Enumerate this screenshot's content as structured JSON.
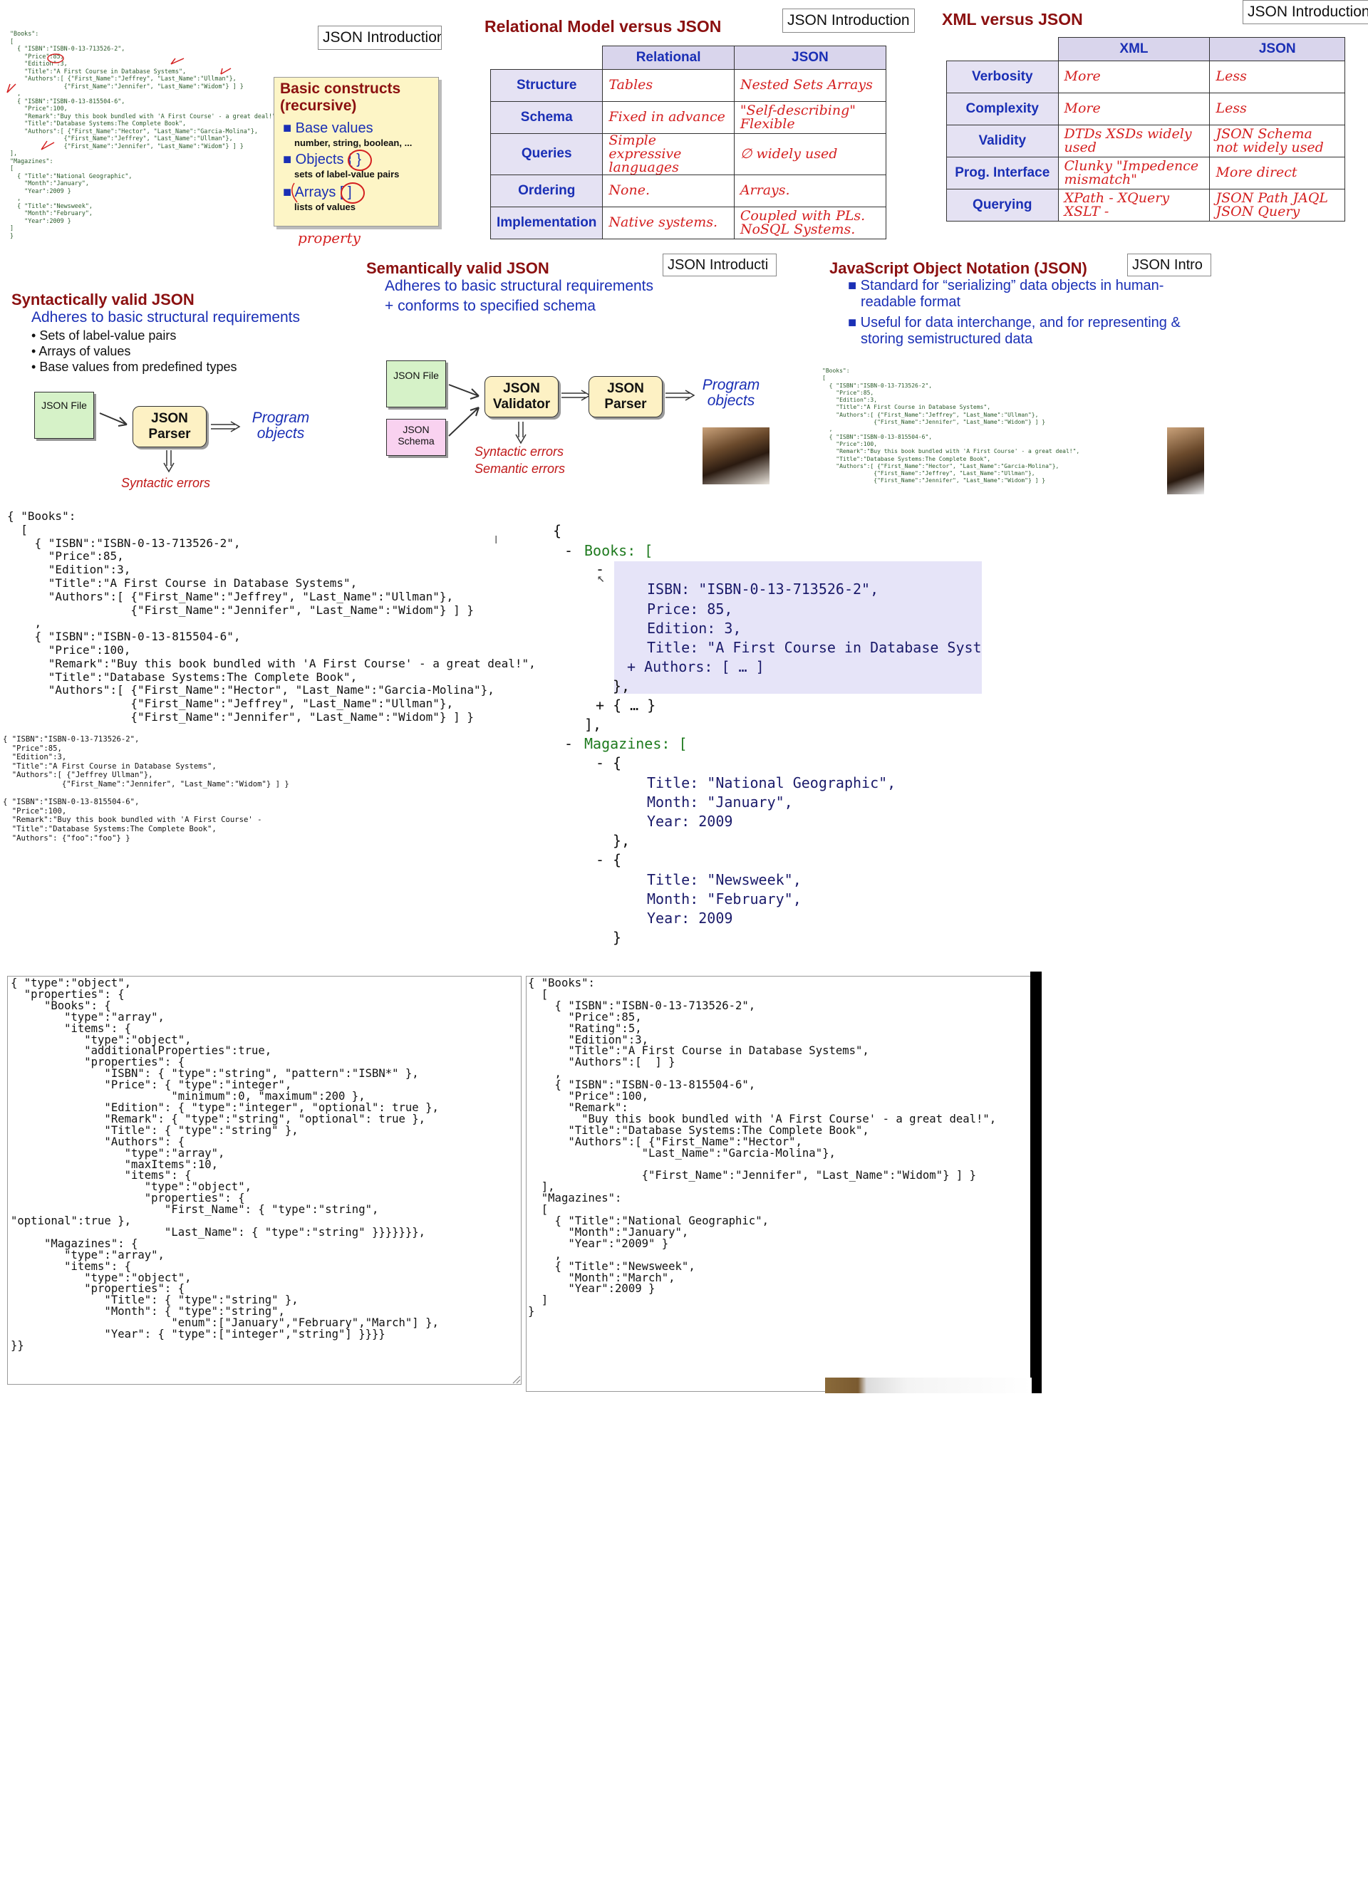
{
  "slide1": {
    "intro_label": "JSON Introduction",
    "code": "\"Books\":\n[\n  { \"ISBN\":\"ISBN-0-13-713526-2\",\n    \"Price\":85,\n    \"Edition\":3,\n    \"Title\":\"A First Course in Database Systems\",\n    \"Authors\":[ {\"First_Name\":\"Jeffrey\", \"Last_Name\":\"Ullman\"},\n               {\"First_Name\":\"Jennifer\", \"Last_Name\":\"Widom\"} ] }\n  ,\n  { \"ISBN\":\"ISBN-0-13-815504-6\",\n    \"Price\":100,\n    \"Remark\":\"Buy this book bundled with 'A First Course' - a great deal!\",\n    \"Title\":\"Database Systems:The Complete Book\",\n    \"Authors\":[ {\"First_Name\":\"Hector\", \"Last_Name\":\"Garcia-Molina\"},\n               {\"First_Name\":\"Jeffrey\", \"Last_Name\":\"Ullman\"},\n               {\"First_Name\":\"Jennifer\", \"Last_Name\":\"Widom\"} ] }\n],\n\"Magazines\":\n[\n  { \"Title\":\"National Geographic\",\n    \"Month\":\"January\",\n    \"Year\":2009 }\n  ,\n  { \"Title\":\"Newsweek\",\n    \"Month\":\"February\",\n    \"Year\":2009 }\n]\n}",
    "constructs_title": "Basic constructs (recursive)",
    "base_values": "Base values",
    "base_values_sub": "number, string, boolean, ...",
    "objects": "Objects { }",
    "objects_sub": "sets of label-value pairs",
    "arrays": "Arrays [ ]",
    "arrays_sub": "lists of values",
    "annotation": "property"
  },
  "slide2": {
    "title": "Relational Model versus JSON",
    "intro_label": "JSON Introduction",
    "columns": [
      "Relational",
      "JSON"
    ],
    "rows": [
      {
        "label": "Structure",
        "relational": "Tables",
        "json": "Nested Sets Arrays"
      },
      {
        "label": "Schema",
        "relational": "Fixed in advance",
        "json": "\"Self-describing\" Flexible"
      },
      {
        "label": "Queries",
        "relational": "Simple expressive languages",
        "json": "∅ widely used"
      },
      {
        "label": "Ordering",
        "relational": "None.",
        "json": "Arrays."
      },
      {
        "label": "Implementation",
        "relational": "Native systems.",
        "json": "Coupled with PLs. NoSQL Systems."
      }
    ]
  },
  "slide3": {
    "title": "XML versus JSON",
    "intro_label": "JSON Introduction",
    "columns": [
      "XML",
      "JSON"
    ],
    "rows": [
      {
        "label": "Verbosity",
        "xml": "More",
        "json": "Less"
      },
      {
        "label": "Complexity",
        "xml": "More",
        "json": "Less"
      },
      {
        "label": "Validity",
        "xml": "DTDs XSDs widely used",
        "json": "JSON Schema not widely used"
      },
      {
        "label": "Prog. Interface",
        "xml": "Clunky \"Impedence mismatch\"",
        "json": "More direct"
      },
      {
        "label": "Querying",
        "xml": "XPath - XQuery XSLT -",
        "json": "JSON Path JAQL JSON Query"
      }
    ]
  },
  "slide4": {
    "title": "Syntactically valid JSON",
    "subtitle": "Adheres to basic structural requirements",
    "bullets": [
      "Sets of label-value pairs",
      "Arrays of values",
      "Base values from predefined types"
    ],
    "file_label": "JSON File",
    "parser_label": "JSON Parser",
    "output_label": "Program objects",
    "error_label": "Syntactic errors"
  },
  "slide5": {
    "title": "Semantically valid JSON",
    "intro_label": "JSON Introducti",
    "line1": "Adheres to basic structural requirements",
    "line2": "+ conforms to specified schema",
    "file_label": "JSON File",
    "schema_label": "JSON Schema",
    "validator_label": "JSON Validator",
    "parser_label": "JSON Parser",
    "output_label": "Program objects",
    "error1": "Syntactic errors",
    "error2": "Semantic errors"
  },
  "slide6": {
    "title": "JavaScript Object Notation (JSON)",
    "intro_label": "JSON Intro",
    "bullet1": "Standard for “serializing” data objects in human-readable format",
    "bullet2": "Useful for data interchange, and for representing & storing semistructured data",
    "code": "\"Books\":\n[\n  { \"ISBN\":\"ISBN-0-13-713526-2\",\n    \"Price\":85,\n    \"Edition\":3,\n    \"Title\":\"A First Course in Database Systems\",\n    \"Authors\":[ {\"First_Name\":\"Jeffrey\", \"Last_Name\":\"Ullman\"},\n               {\"First_Name\":\"Jennifer\", \"Last_Name\":\"Widom\"} ] }\n  ,\n  { \"ISBN\":\"ISBN-0-13-815504-6\",\n    \"Price\":100,\n    \"Remark\":\"Buy this book bundled with 'A First Course' - a great deal!\",\n    \"Title\":\"Database Systems:The Complete Book\",\n    \"Authors\":[ {\"First_Name\":\"Hector\", \"Last_Name\":\"Garcia-Molina\"},\n               {\"First_Name\":\"Jeffrey\", \"Last_Name\":\"Ullman\"},\n               {\"First_Name\":\"Jennifer\", \"Last_Name\":\"Widom\"} ] }"
  },
  "editor1": {
    "code": "{ \"Books\":\n  [\n    { \"ISBN\":\"ISBN-0-13-713526-2\",\n      \"Price\":85,\n      \"Edition\":3,\n      \"Title\":\"A First Course in Database Systems\",\n      \"Authors\":[ {\"First_Name\":\"Jeffrey\", \"Last_Name\":\"Ullman\"},\n                  {\"First_Name\":\"Jennifer\", \"Last_Name\":\"Widom\"} ] }\n    ,\n    { \"ISBN\":\"ISBN-0-13-815504-6\",\n      \"Price\":100,\n      \"Remark\":\"Buy this book bundled with 'A First Course' - a great deal!\",\n      \"Title\":\"Database Systems:The Complete Book\",\n      \"Authors\":[ {\"First_Name\":\"Hector\", \"Last_Name\":\"Garcia-Molina\"},\n                  {\"First_Name\":\"Jeffrey\", \"Last_Name\":\"Ullman\"},\n                  {\"First_Name\":\"Jennifer\", \"Last_Name\":\"Widom\"} ] }"
  },
  "editor2": {
    "code": "{ \"ISBN\":\"ISBN-0-13-713526-2\",\n  \"Price\":85,\n  \"Edition\":3,\n  \"Title\":\"A First Course in Database Systems\",\n  \"Authors\":[ {\"Jeffrey Ullman\"},\n             {\"First_Name\":\"Jennifer\", \"Last_Name\":\"Widom\"} ] }\n\n{ \"ISBN\":\"ISBN-0-13-815504-6\",\n  \"Price\":100,\n  \"Remark\":\"Buy this book bundled with 'A First Course' -\n  \"Title\":\"Database Systems:The Complete Book\",\n  \"Authors\": {\"foo\":\"foo\"} }"
  },
  "viewer": {
    "open": "{",
    "books_key": "Books: [",
    "book1": {
      "isbn": "ISBN: \"ISBN-0-13-713526-2\",",
      "price": "Price: 85,",
      "edition": "Edition: 3,",
      "title": "Title: \"A First Course in Database System",
      "authors": "+ Authors: [ … ]"
    },
    "book1_close": "},",
    "book2_collapsed": "+ { … }",
    "books_close": "],",
    "magazines_key": "Magazines: [",
    "mag1": {
      "title": "Title: \"National Geographic\",",
      "month": "Month: \"January\",",
      "year": "Year: 2009"
    },
    "mag1_close": "},",
    "mag2": {
      "title": "Title: \"Newsweek\",",
      "month": "Month: \"February\",",
      "year": "Year: 2009"
    },
    "mag2_close": "}",
    "collapse_marker": "-",
    "expand_marker": "+"
  },
  "schema_editor": {
    "code": "{ \"type\":\"object\",\n  \"properties\": {\n     \"Books\": {\n        \"type\":\"array\",\n        \"items\": {\n           \"type\":\"object\",\n           \"additionalProperties\":true,\n           \"properties\": {\n              \"ISBN\": { \"type\":\"string\", \"pattern\":\"ISBN*\" },\n              \"Price\": { \"type\":\"integer\",\n                        \"minimum\":0, \"maximum\":200 },\n              \"Edition\": { \"type\":\"integer\", \"optional\": true },\n              \"Remark\": { \"type\":\"string\", \"optional\": true },\n              \"Title\": { \"type\":\"string\" },\n              \"Authors\": {\n                 \"type\":\"array\",\n                 \"maxItems\":10,\n                 \"items\": {\n                    \"type\":\"object\",\n                    \"properties\": {\n                       \"First_Name\": { \"type\":\"string\",\n\"optional\":true },\n                       \"Last_Name\": { \"type\":\"string\" }}}}}}},\n     \"Magazines\": {\n        \"type\":\"array\",\n        \"items\": {\n           \"type\":\"object\",\n           \"properties\": {\n              \"Title\": { \"type\":\"string\" },\n              \"Month\": { \"type\":\"string\",\n                        \"enum\":[\"January\",\"February\",\"March\"] },\n              \"Year\": { \"type\":[\"integer\",\"string\"] }}}}\n}}"
  },
  "data_editor": {
    "code": "{ \"Books\":\n  [\n    { \"ISBN\":\"ISBN-0-13-713526-2\",\n      \"Price\":85,\n      \"Rating\":5,\n      \"Edition\":3,\n      \"Title\":\"A First Course in Database Systems\",\n      \"Authors\":[  ] }\n    ,\n    { \"ISBN\":\"ISBN-0-13-815504-6\",\n      \"Price\":100,\n      \"Remark\":\n        \"Buy this book bundled with 'A First Course' - a great deal!\",\n      \"Title\":\"Database Systems:The Complete Book\",\n      \"Authors\":[ {\"First_Name\":\"Hector\",\n                 \"Last_Name\":\"Garcia-Molina\"},\n\n                 {\"First_Name\":\"Jennifer\", \"Last_Name\":\"Widom\"} ] }\n  ],\n  \"Magazines\":\n  [\n    { \"Title\":\"National Geographic\",\n      \"Month\":\"January\",\n      \"Year\":\"2009\" }\n    ,\n    { \"Title\":\"Newsweek\",\n      \"Month\":\"March\",\n      \"Year\":2009 }\n  ]\n}"
  },
  "colors": {
    "slide_title": "#8b1010",
    "accent_blue": "#1a2fb5",
    "handwriting": "#d42020",
    "table_header": "#d9d5ec",
    "highlight": "#e6e4f8",
    "json_key_green": "#1e7a1e",
    "parser_box": "#fdf1c4"
  },
  "icons": [
    "arrow-icon",
    "cursor-icon",
    "resize-grip-icon",
    "speaker-video-thumbnail"
  ]
}
